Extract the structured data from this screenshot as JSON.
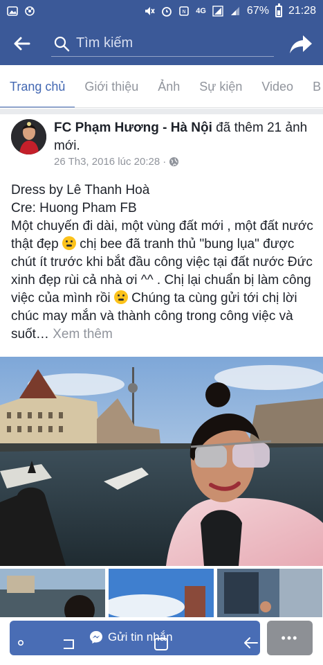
{
  "status_bar": {
    "battery": "67%",
    "time": "21:28",
    "network": "4G",
    "icons": [
      "photo-icon",
      "settings-wheel-icon",
      "mute-icon",
      "alarm-icon",
      "nfc-icon",
      "signal-icon",
      "battery-icon"
    ]
  },
  "header": {
    "search_placeholder": "Tìm kiếm",
    "accent_color": "#3b5998"
  },
  "tabs": [
    {
      "label": "Trang chủ",
      "active": true
    },
    {
      "label": "Giới thiệu",
      "active": false
    },
    {
      "label": "Ảnh",
      "active": false
    },
    {
      "label": "Sự kiện",
      "active": false
    },
    {
      "label": "Video",
      "active": false
    },
    {
      "label": "B",
      "active": false
    }
  ],
  "post": {
    "page_name": "FC Phạm Hương - Hà Nội",
    "action": " đã thêm 21 ảnh mới.",
    "timestamp": "26 Th3, 2016 lúc 20:28",
    "privacy_icon": "globe-icon",
    "lines": {
      "line1": "Dress by Lê Thanh Hoà",
      "line2": "Cre: Huong Pham FB",
      "body1": "Một chuyến đi dài, một vùng đất mới , một đất nước thật đẹp ",
      "body2": " chị bee đã tranh thủ \"bung lụa\" được chút ít trước khi bắt đầu công việc tại đất nước Đức xinh đẹp rùi cả nhà ơi ^^ . Chị lại chuẩn bị làm công việc của mình rồi ",
      "body3": " Chúng ta cùng gửi tới chị lời chúc may mắn và thành công trong công việc và suốt… ",
      "see_more": "Xem thêm"
    }
  },
  "bottom": {
    "message_label": "Gửi tin nhắn",
    "more_label": "•••"
  }
}
